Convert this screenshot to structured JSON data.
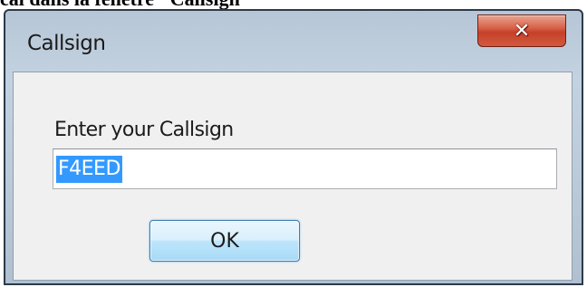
{
  "page_caption": "cal dans la fenêtre \"Callsign",
  "window": {
    "title": "Callsign",
    "close_icon": "close-icon"
  },
  "dialog": {
    "prompt": "Enter your Callsign",
    "input_value": "F4EED",
    "input_selected": true,
    "ok_label": "OK"
  },
  "colors": {
    "selection": "#3399ff",
    "close_button": "#c6402a",
    "ok_button_border": "#3c7fb1"
  }
}
